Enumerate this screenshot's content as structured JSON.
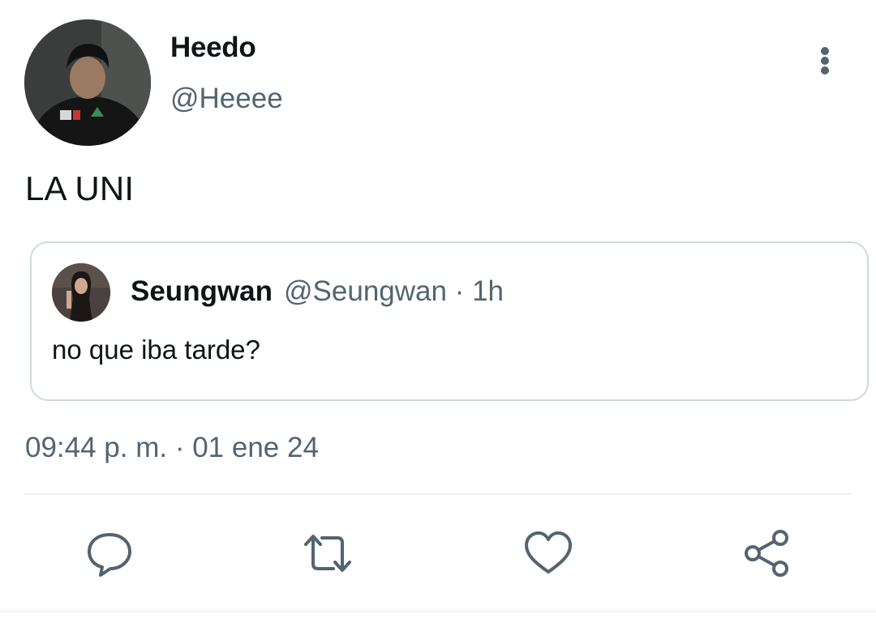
{
  "author": {
    "display_name": "Heedo",
    "handle": "@Heeee",
    "avatar_icon": "user-avatar-photo"
  },
  "tweet": {
    "text": "LA UNI",
    "timestamp": "09:44 p. m. · 01 ene 24"
  },
  "quoted_tweet": {
    "display_name": "Seungwan",
    "handle": "@Seungwan",
    "time": " · 1h",
    "text": "no que iba tarde?",
    "avatar_icon": "quoted-user-avatar-photo"
  },
  "actions": [
    {
      "icon": "reply-icon"
    },
    {
      "icon": "retweet-icon"
    },
    {
      "icon": "like-icon"
    },
    {
      "icon": "share-icon"
    }
  ],
  "colors": {
    "primary_text": "#0f1419",
    "secondary_text": "#536471",
    "border": "#cfd9de",
    "divider": "#eff3f4",
    "background": "#ffffff"
  }
}
